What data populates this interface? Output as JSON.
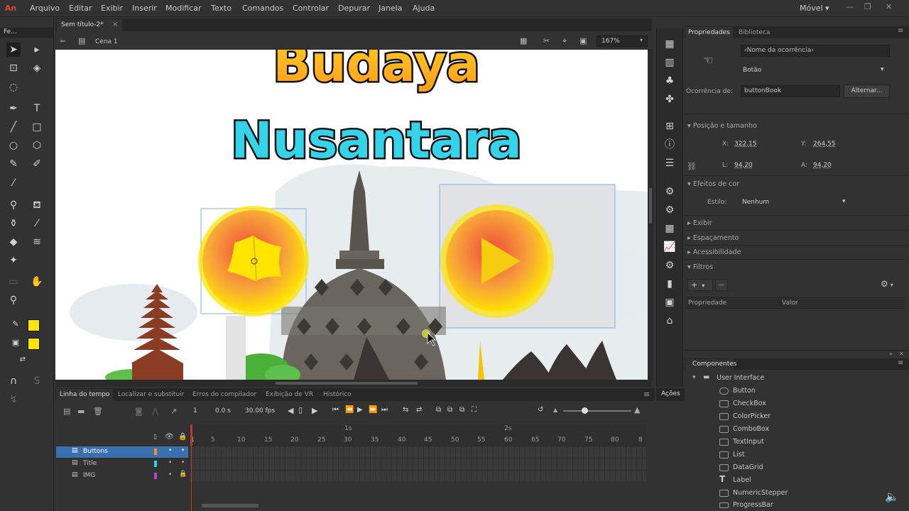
{
  "app": {
    "logo": "An"
  },
  "menu": [
    "Arquivo",
    "Editar",
    "Exibir",
    "Inserir",
    "Modificar",
    "Texto",
    "Comandos",
    "Controlar",
    "Depurar",
    "Janela",
    "Ajuda"
  ],
  "workspace": {
    "label": "Móvel ▾"
  },
  "toolpanel": {
    "title": "Fe..."
  },
  "document": {
    "tab": "Sem título-2*",
    "tab_close": "×",
    "scene": "Cena 1",
    "zoom": "167%"
  },
  "stage": {
    "title_line1": "Budaya",
    "title_line2": "Nusantara"
  },
  "properties": {
    "tabs": [
      "Propriedades",
      "Biblioteca"
    ],
    "instance_name_placeholder": "‹Nome da ocorrência›",
    "instance_type": "Botão",
    "instance_of_label": "Ocorrência de:",
    "instance_of_value": "buttonBook",
    "swap_button": "Alternar...",
    "pos_size_section": "Posição e tamanho",
    "x_label": "X:",
    "x_value": "322,15",
    "y_label": "Y:",
    "y_value": "264,55",
    "w_label": "L:",
    "w_value": "94,20",
    "h_label": "A:",
    "h_value": "94,20",
    "color_effect_section": "Efeitos de cor",
    "style_label": "Estilo:",
    "style_value": "Nenhum",
    "display_section": "Exibir",
    "spacing_section": "Espaçamento",
    "accessibility_section": "Acessibilidade",
    "filters_section": "Filtros",
    "filter_col_property": "Propriedade",
    "filter_col_value": "Valor"
  },
  "components": {
    "title": "Componentes",
    "folder": "User Interface",
    "items": [
      "Button",
      "CheckBox",
      "ColorPicker",
      "ComboBox",
      "TextInput",
      "List",
      "DataGrid",
      "Label",
      "NumericStepper",
      "ProgressBar"
    ]
  },
  "timeline": {
    "tabs": [
      "Linha do tempo",
      "Localizar e substituir",
      "Erros do compilador",
      "Exibição de VR",
      "Histórico"
    ],
    "current_frame": "1",
    "time": "0.0 s",
    "fps": "30.00 fps",
    "layers": [
      "Buttons",
      "Title",
      "IMG"
    ],
    "layer_colors": [
      "#ff8a2a",
      "#2ad4e6",
      "#b048d0"
    ],
    "frame_numbers": [
      "1",
      "5",
      "10",
      "15",
      "20",
      "25",
      "30",
      "35",
      "40",
      "45",
      "50",
      "55",
      "60",
      "65",
      "70",
      "75",
      "80",
      "8"
    ],
    "second_markers": [
      "1s",
      "2s"
    ]
  },
  "actions_panel": {
    "label": "Ações"
  },
  "colors": {
    "accent_selection": "#3a6fb0",
    "playhead": "#c0392b",
    "yellow": "#ffe400"
  }
}
